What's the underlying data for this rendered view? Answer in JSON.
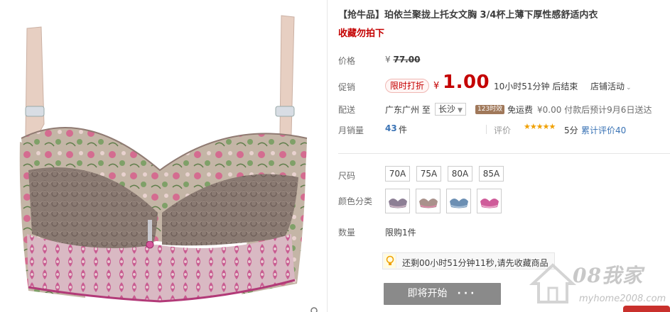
{
  "product": {
    "title": "【抢牛品】珀依兰聚拢上托女文胸 3/4杯上薄下厚性感舒适内衣",
    "subtitle": "收藏勿拍下",
    "image_alt": "bra-product-photo"
  },
  "price_row": {
    "label": "价格",
    "currency": "¥",
    "original_price": "77.00"
  },
  "promo_row": {
    "label": "促销",
    "badge": "限时打折",
    "currency": "¥",
    "price": "1.00",
    "countdown": "10小时51分钟 后结束",
    "shop_activity": "店铺活动"
  },
  "delivery_row": {
    "label": "配送",
    "from": "广东广州 至",
    "to_city": "长沙",
    "tag": "123时效",
    "free_shipping": "免运费",
    "fee_text": "¥0.00 付款后预计9月6日送达"
  },
  "sales_row": {
    "label": "月销量",
    "count": "43",
    "unit": "件",
    "review_label": "评价",
    "stars": "★★★★★",
    "score": "5分",
    "review_text": "累计评价40"
  },
  "size_row": {
    "label": "尺码",
    "options": [
      "70A",
      "75A",
      "80A",
      "85A"
    ]
  },
  "color_row": {
    "label": "颜色分类",
    "options": [
      {
        "name": "gray-blue",
        "color": "#8d7f95"
      },
      {
        "name": "mocha",
        "color": "#a9918b"
      },
      {
        "name": "blue",
        "color": "#6c8fb3"
      },
      {
        "name": "rose",
        "color": "#cf5c9a"
      }
    ]
  },
  "quantity_row": {
    "label": "数量",
    "limit": "限购1件"
  },
  "notice": {
    "text": "还剩00小时51分钟11秒,请先收藏商品"
  },
  "action_button": {
    "label": "即将开始",
    "dots": "···"
  },
  "watermark": {
    "title": "08我家",
    "url": "myhome2008.com"
  },
  "colors": {
    "accent": "#c40000",
    "link": "#3a73b5",
    "button": "#8a8a8a"
  }
}
